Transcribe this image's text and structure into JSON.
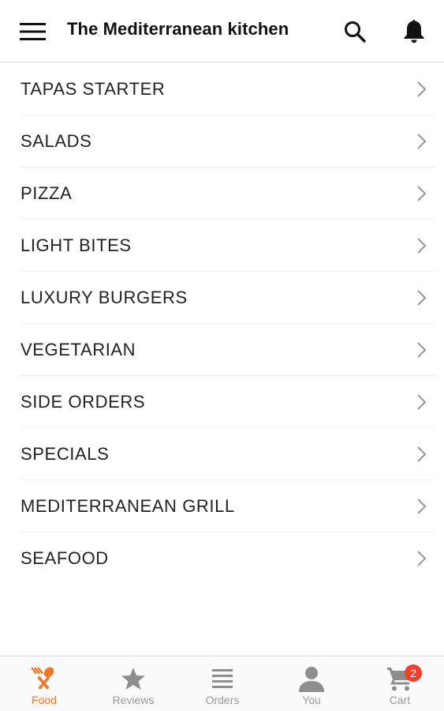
{
  "header": {
    "title": "The Mediterranean kitchen",
    "menu_icon": "hamburger-menu-icon",
    "search_icon": "search-icon",
    "notification_icon": "bell-icon"
  },
  "categories": [
    {
      "label": "TAPAS STARTER"
    },
    {
      "label": "SALADS"
    },
    {
      "label": "PIZZA"
    },
    {
      "label": "LIGHT BITES"
    },
    {
      "label": "LUXURY BURGERS"
    },
    {
      "label": "VEGETARIAN"
    },
    {
      "label": "SIDE ORDERS"
    },
    {
      "label": "SPECIALS"
    },
    {
      "label": "MEDITERRANEAN GRILL"
    },
    {
      "label": "SEAFOOD"
    }
  ],
  "bottom_nav": {
    "items": [
      {
        "label": "Food",
        "icon": "fork-spoon-icon",
        "active": true
      },
      {
        "label": "Reviews",
        "icon": "star-icon",
        "active": false
      },
      {
        "label": "Orders",
        "icon": "list-icon",
        "active": false
      },
      {
        "label": "You",
        "icon": "person-icon",
        "active": false
      },
      {
        "label": "Cart",
        "icon": "cart-icon",
        "active": false
      }
    ],
    "cart_count": "2"
  },
  "colors": {
    "accent": "#f07722",
    "badge": "#f2402a",
    "inactive": "#9a9a9a"
  }
}
